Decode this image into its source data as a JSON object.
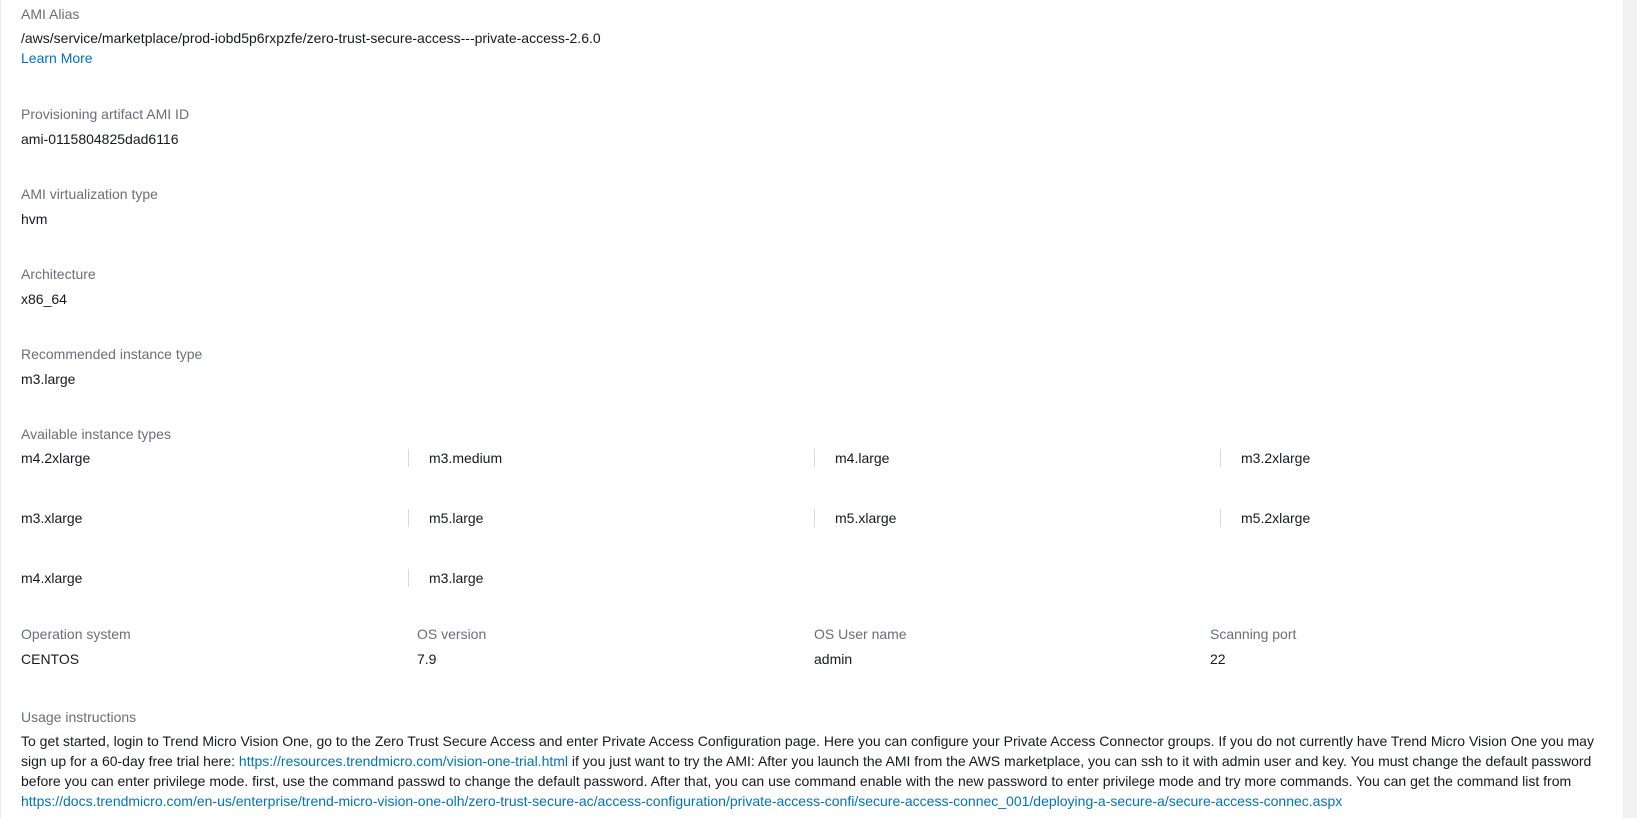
{
  "ami_alias": {
    "label": "AMI Alias",
    "value": "/aws/service/marketplace/prod-iobd5p6rxpzfe/zero-trust-secure-access---private-access-2.6.0",
    "learn_more": "Learn More"
  },
  "provisioning_ami_id": {
    "label": "Provisioning artifact AMI ID",
    "value": "ami-0115804825dad6116"
  },
  "virtualization_type": {
    "label": "AMI virtualization type",
    "value": "hvm"
  },
  "architecture": {
    "label": "Architecture",
    "value": "x86_64"
  },
  "recommended_instance": {
    "label": "Recommended instance type",
    "value": "m3.large"
  },
  "available_instances": {
    "label": "Available instance types",
    "items": [
      "m4.2xlarge",
      "m3.medium",
      "m4.large",
      "m3.2xlarge",
      "m3.xlarge",
      "m5.large",
      "m5.xlarge",
      "m5.2xlarge",
      "m4.xlarge",
      "m3.large"
    ]
  },
  "os": {
    "system_label": "Operation system",
    "system_value": "CENTOS",
    "version_label": "OS version",
    "version_value": "7.9",
    "username_label": "OS User name",
    "username_value": "admin",
    "port_label": "Scanning port",
    "port_value": "22"
  },
  "usage": {
    "label": "Usage instructions",
    "text1": "To get started, login to Trend Micro Vision One, go to the Zero Trust Secure Access and enter Private Access Configuration page. Here you can configure your Private Access Connector groups. If you do not currently have Trend Micro Vision One you may sign up for a 60-day free trial here: ",
    "link1": "https://resources.trendmicro.com/vision-one-trial.html",
    "text2": " if you just want to try the AMI: After you launch the AMI from the AWS marketplace, you can ssh to it with admin user and key. You must change the default password before you can enter privilege mode. first, use the command passwd to change the default password. After that, you can use command enable with the new password to enter privilege mode and try more commands. You can get the command list from ",
    "link2": "https://docs.trendmicro.com/en-us/enterprise/trend-micro-vision-one-olh/zero-trust-secure-ac/access-configuration/private-access-confi/secure-access-connec_001/deploying-a-secure-a/secure-access-connec.aspx"
  },
  "colors": {
    "label": "#687078",
    "value": "#16191f",
    "link": "#0073bb",
    "divider": "#d5dbdb"
  }
}
